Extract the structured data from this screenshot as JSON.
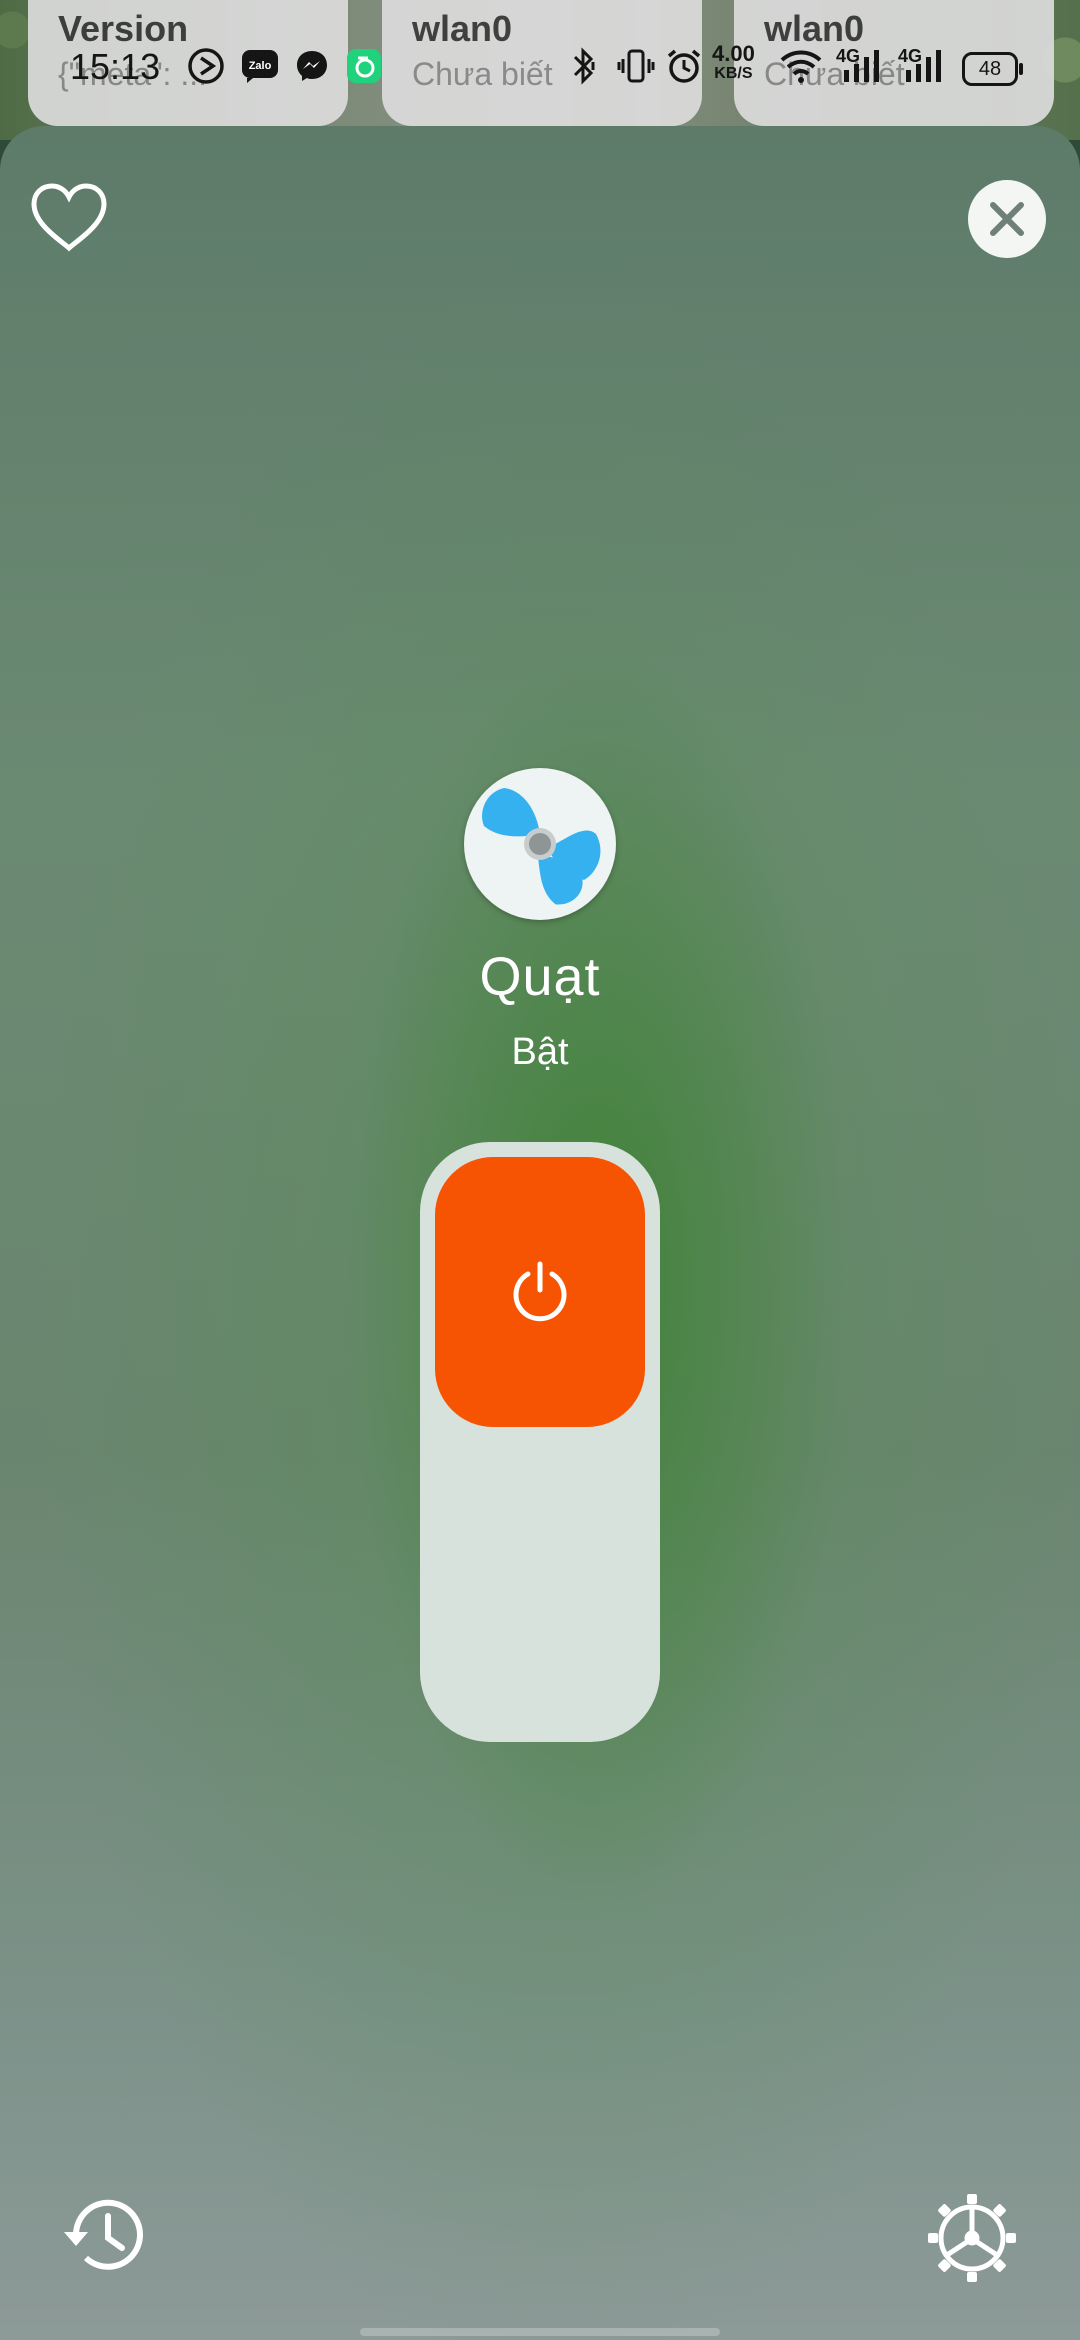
{
  "background_cards": [
    {
      "title": "Version",
      "subtitle": "{\"meta\": ..."
    },
    {
      "title": "wlan0",
      "subtitle": "Chưa biết"
    },
    {
      "title": "wlan0",
      "subtitle": "Chưa biết"
    }
  ],
  "status_bar": {
    "time": "15:13",
    "net_speed": "4.00",
    "net_unit": "KB/S",
    "signal1_label": "4G",
    "signal2_label": "4G",
    "battery": "48",
    "notification_icons": [
      "navigation-icon",
      "zalo-icon",
      "messenger-icon",
      "app-icon"
    ],
    "app_icon_text": "Zalo"
  },
  "device": {
    "name": "Quạt",
    "state": "Bật",
    "icon": "fan-icon",
    "power_on": true
  },
  "colors": {
    "accent": "#f65402",
    "slider_track": "#d8e2dc",
    "fan_blue": "#35b1f0"
  }
}
